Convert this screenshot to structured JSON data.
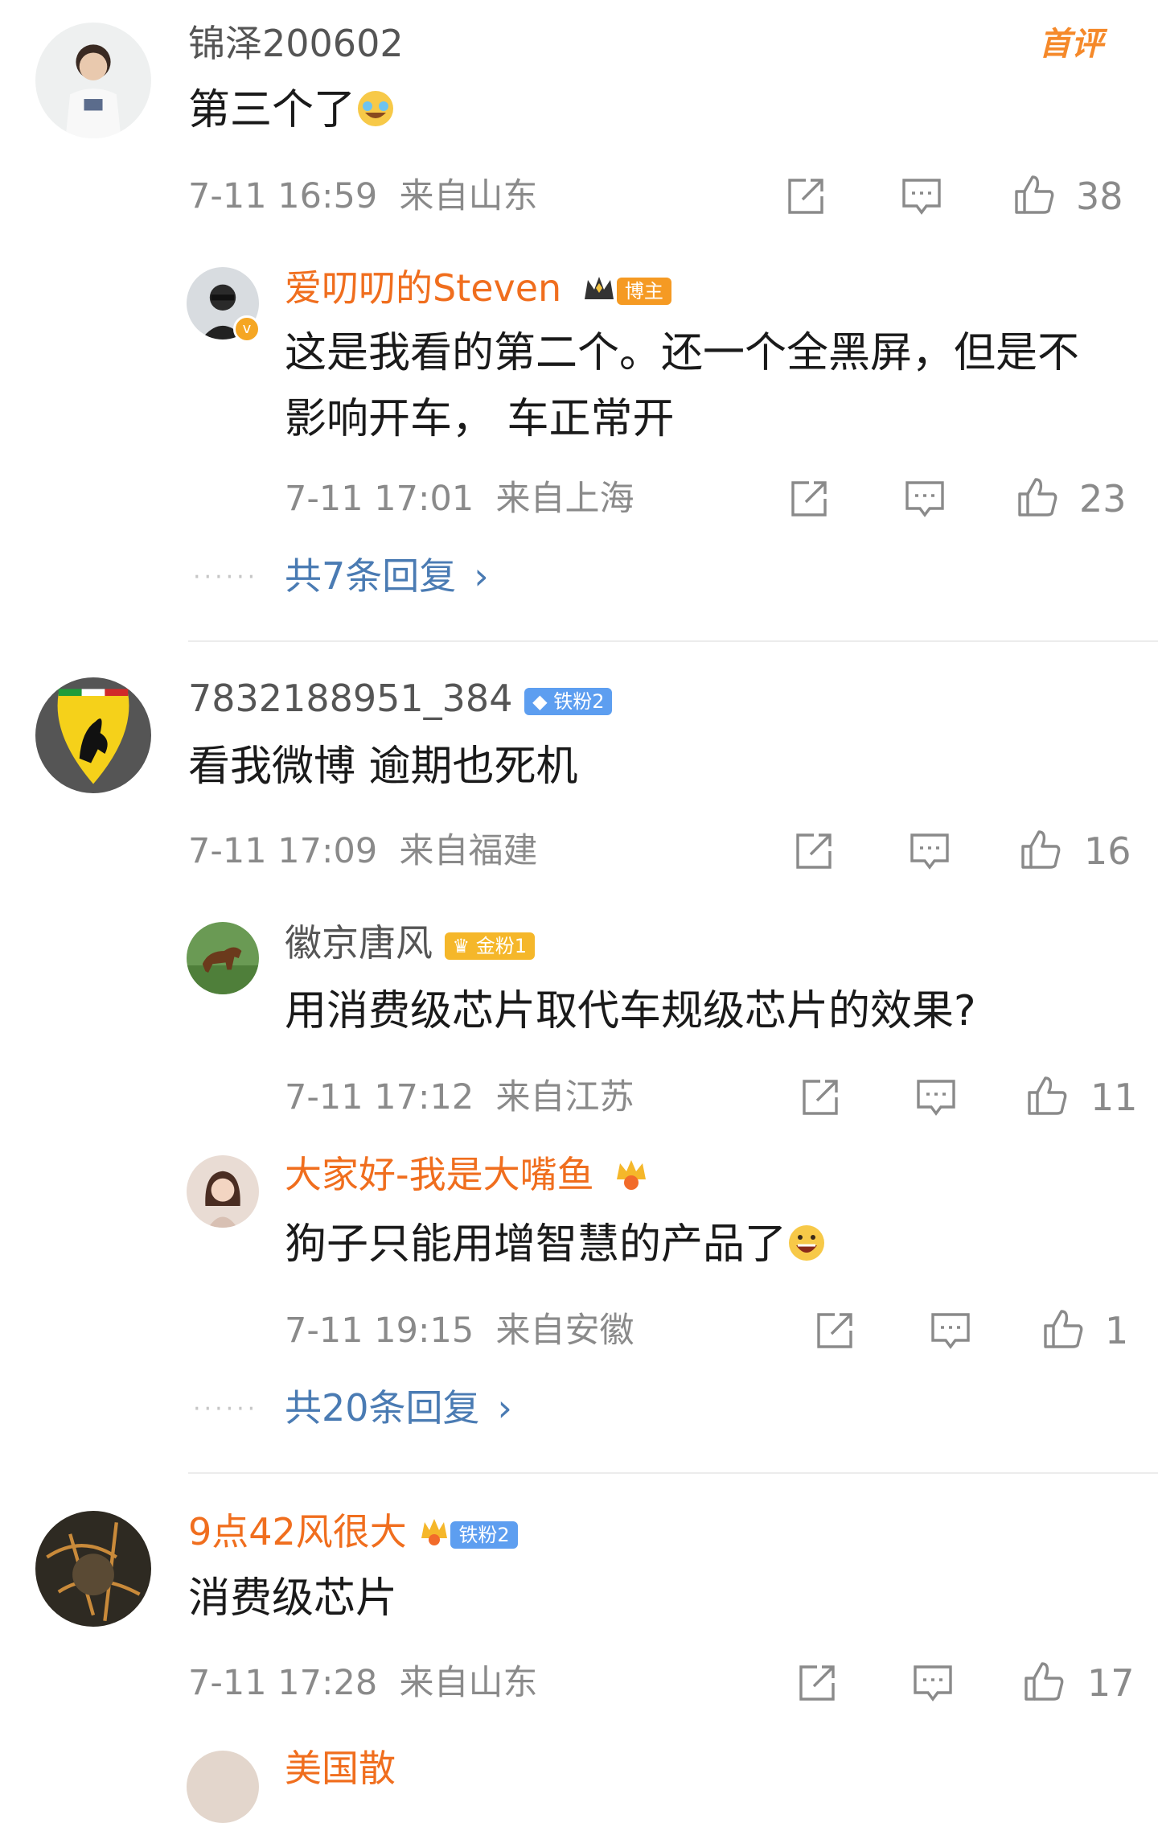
{
  "comments": [
    {
      "user": "锦泽200602",
      "tag": "首评",
      "text": "第三个了",
      "time": "7-11 16:59",
      "location": "来自山东",
      "likes": "38",
      "avatar_icon": "user-avatar-icon",
      "replies": [
        {
          "user": "爱叨叨的Steven",
          "badge": "博主",
          "text_line1": "这是我看的第二个。还一个全黑屏，但是不",
          "text_line2": "影响开车， 车正常开",
          "time": "7-11 17:01",
          "location": "来自上海",
          "likes": "23"
        }
      ],
      "more": "共7条回复"
    },
    {
      "user": "7832188951_384",
      "badge": "铁粉2",
      "text": "看我微博 逾期也死机",
      "time": "7-11 17:09",
      "location": "来自福建",
      "likes": "16",
      "replies": [
        {
          "user": "徽京唐风",
          "badge": "金粉1",
          "text": "用消费级芯片取代车规级芯片的效果?",
          "time": "7-11 17:12",
          "location": "来自江苏",
          "likes": "11"
        },
        {
          "user": "大家好-我是大嘴鱼",
          "text": "狗子只能用增智慧的产品了",
          "time": "7-11 19:15",
          "location": "来自安徽",
          "likes": "1"
        }
      ],
      "more": "共20条回复"
    },
    {
      "user": "9点42风很大",
      "badge": "铁粉2",
      "text": "消费级芯片",
      "time": "7-11 17:28",
      "location": "来自山东",
      "likes": "17"
    }
  ],
  "next_user_partial": "美国散",
  "colors": {
    "vip_name": "#f06e1e",
    "link": "#4a7bb3",
    "meta": "#8a8a8a"
  }
}
